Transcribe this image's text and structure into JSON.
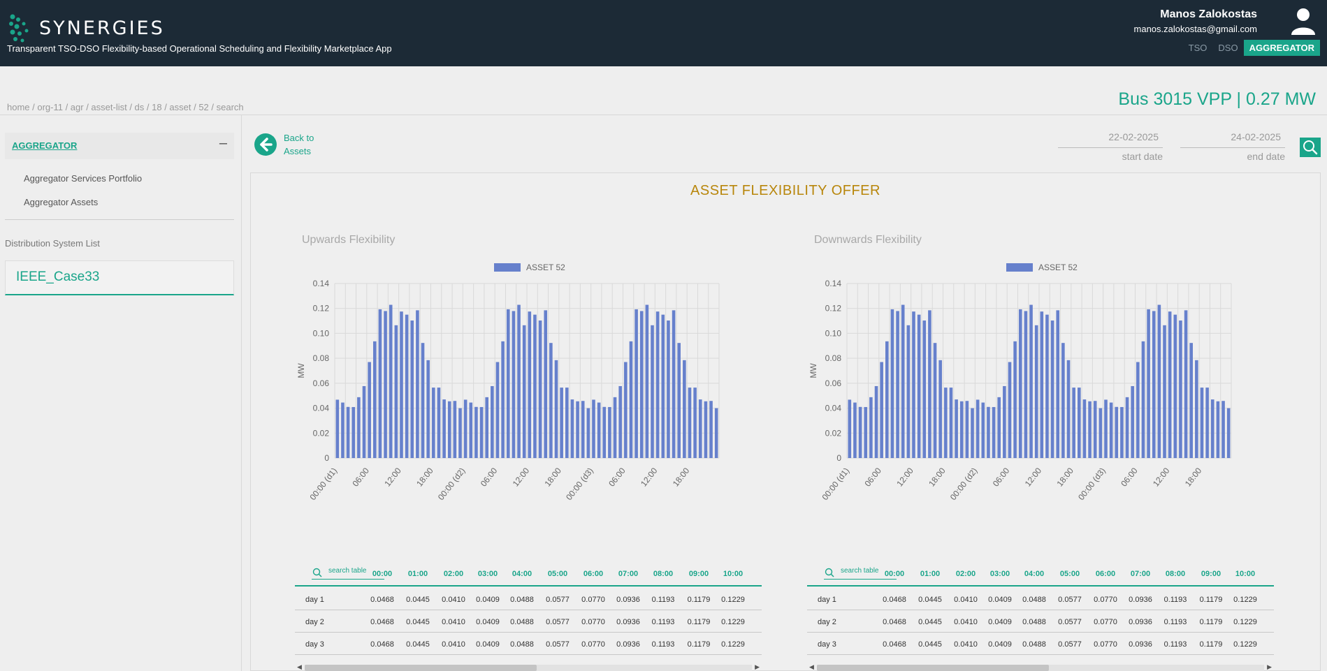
{
  "header": {
    "logo_text": "SYNERGIES",
    "subtitle": "Transparent TSO-DSO Flexibility-based Operational Scheduling and Flexibility Marketplace App",
    "user_name": "Manos Zalokostas",
    "user_email": "manos.zalokostas@gmail.com",
    "roles": [
      "TSO",
      "DSO",
      "AGGREGATOR"
    ],
    "active_role": "AGGREGATOR",
    "accent_color": "#1aa58a",
    "bg_color": "#1c2a36"
  },
  "breadcrumb": "home / org-11 / agr / asset-list / ds / 18 / asset / 52 / search",
  "page_title": "Bus 3015 VPP | 0.27 MW",
  "sidebar": {
    "section_label": "AGGREGATOR",
    "collapse_symbol": "–",
    "items": [
      "Aggregator Services Portfolio",
      "Aggregator Assets"
    ],
    "ds_heading": "Distribution System List",
    "ds_selected": "IEEE_Case33"
  },
  "back_button": "Back to Assets",
  "dates": {
    "start_value": "22-02-2025",
    "start_label": "start date",
    "end_value": "24-02-2025",
    "end_label": "end date"
  },
  "panel_title": "ASSET FLEXIBILITY OFFER",
  "chart_data": [
    {
      "type": "bar",
      "title": "Upwards Flexibility",
      "ylabel": "MW",
      "ylim": [
        0,
        0.14
      ],
      "yticks": [
        "0",
        "0.02",
        "0.04",
        "0.06",
        "0.08",
        "0.10",
        "0.12",
        "0.14"
      ],
      "xtick_labels": [
        "00:00 (d1)",
        "06:00",
        "12:00",
        "18:00",
        "00:00 (d2)",
        "06:00",
        "12:00",
        "18:00",
        "00:00 (d3)",
        "06:00",
        "12:00",
        "18:00"
      ],
      "legend": "top-center",
      "color": "#6680cc",
      "series": [
        {
          "name": "ASSET 52",
          "values": [
            0.0468,
            0.0445,
            0.041,
            0.0409,
            0.0488,
            0.0577,
            0.077,
            0.0936,
            0.1193,
            0.1179,
            0.1229,
            0.1065,
            0.1175,
            0.115,
            0.1103,
            0.1185,
            0.0923,
            0.0785,
            0.0565,
            0.0565,
            0.047,
            0.0455,
            0.0458,
            0.04,
            0.0468,
            0.0445,
            0.041,
            0.0409,
            0.0488,
            0.0577,
            0.077,
            0.0936,
            0.1193,
            0.1179,
            0.1229,
            0.1065,
            0.1175,
            0.115,
            0.1103,
            0.1185,
            0.0923,
            0.0785,
            0.0565,
            0.0565,
            0.047,
            0.0455,
            0.0458,
            0.04,
            0.0468,
            0.0445,
            0.041,
            0.0409,
            0.0488,
            0.0577,
            0.077,
            0.0936,
            0.1193,
            0.1179,
            0.1229,
            0.1065,
            0.1175,
            0.115,
            0.1103,
            0.1185,
            0.0923,
            0.0785,
            0.0565,
            0.0565,
            0.047,
            0.0455,
            0.0458,
            0.04
          ]
        }
      ]
    },
    {
      "type": "bar",
      "title": "Downwards Flexibility",
      "ylabel": "MW",
      "ylim": [
        0,
        0.14
      ],
      "yticks": [
        "0",
        "0.02",
        "0.04",
        "0.06",
        "0.08",
        "0.10",
        "0.12",
        "0.14"
      ],
      "xtick_labels": [
        "00:00 (d1)",
        "06:00",
        "12:00",
        "18:00",
        "00:00 (d2)",
        "06:00",
        "12:00",
        "18:00",
        "00:00 (d3)",
        "06:00",
        "12:00",
        "18:00"
      ],
      "legend": "top-center",
      "color": "#6680cc",
      "series": [
        {
          "name": "ASSET 52",
          "values": [
            0.0468,
            0.0445,
            0.041,
            0.0409,
            0.0488,
            0.0577,
            0.077,
            0.0936,
            0.1193,
            0.1179,
            0.1229,
            0.1065,
            0.1175,
            0.115,
            0.1103,
            0.1185,
            0.0923,
            0.0785,
            0.0565,
            0.0565,
            0.047,
            0.0455,
            0.0458,
            0.04,
            0.0468,
            0.0445,
            0.041,
            0.0409,
            0.0488,
            0.0577,
            0.077,
            0.0936,
            0.1193,
            0.1179,
            0.1229,
            0.1065,
            0.1175,
            0.115,
            0.1103,
            0.1185,
            0.0923,
            0.0785,
            0.0565,
            0.0565,
            0.047,
            0.0455,
            0.0458,
            0.04,
            0.0468,
            0.0445,
            0.041,
            0.0409,
            0.0488,
            0.0577,
            0.077,
            0.0936,
            0.1193,
            0.1179,
            0.1229,
            0.1065,
            0.1175,
            0.115,
            0.1103,
            0.1185,
            0.0923,
            0.0785,
            0.0565,
            0.0565,
            0.047,
            0.0455,
            0.0458,
            0.04
          ]
        }
      ]
    }
  ],
  "tables": [
    {
      "search_placeholder": "search table",
      "columns": [
        "00:00",
        "01:00",
        "02:00",
        "03:00",
        "04:00",
        "05:00",
        "06:00",
        "07:00",
        "08:00",
        "09:00",
        "10:00"
      ],
      "rows": [
        {
          "label": "day 1",
          "values": [
            "0.0468",
            "0.0445",
            "0.0410",
            "0.0409",
            "0.0488",
            "0.0577",
            "0.0770",
            "0.0936",
            "0.1193",
            "0.1179",
            "0.1229"
          ]
        },
        {
          "label": "day 2",
          "values": [
            "0.0468",
            "0.0445",
            "0.0410",
            "0.0409",
            "0.0488",
            "0.0577",
            "0.0770",
            "0.0936",
            "0.1193",
            "0.1179",
            "0.1229"
          ]
        },
        {
          "label": "day 3",
          "values": [
            "0.0468",
            "0.0445",
            "0.0410",
            "0.0409",
            "0.0488",
            "0.0577",
            "0.0770",
            "0.0936",
            "0.1193",
            "0.1179",
            "0.1229"
          ]
        }
      ]
    },
    {
      "search_placeholder": "search table",
      "columns": [
        "00:00",
        "01:00",
        "02:00",
        "03:00",
        "04:00",
        "05:00",
        "06:00",
        "07:00",
        "08:00",
        "09:00",
        "10:00"
      ],
      "rows": [
        {
          "label": "day 1",
          "values": [
            "0.0468",
            "0.0445",
            "0.0410",
            "0.0409",
            "0.0488",
            "0.0577",
            "0.0770",
            "0.0936",
            "0.1193",
            "0.1179",
            "0.1229"
          ]
        },
        {
          "label": "day 2",
          "values": [
            "0.0468",
            "0.0445",
            "0.0410",
            "0.0409",
            "0.0488",
            "0.0577",
            "0.0770",
            "0.0936",
            "0.1193",
            "0.1179",
            "0.1229"
          ]
        },
        {
          "label": "day 3",
          "values": [
            "0.0468",
            "0.0445",
            "0.0410",
            "0.0409",
            "0.0488",
            "0.0577",
            "0.0770",
            "0.0936",
            "0.1193",
            "0.1179",
            "0.1229"
          ]
        }
      ]
    }
  ]
}
